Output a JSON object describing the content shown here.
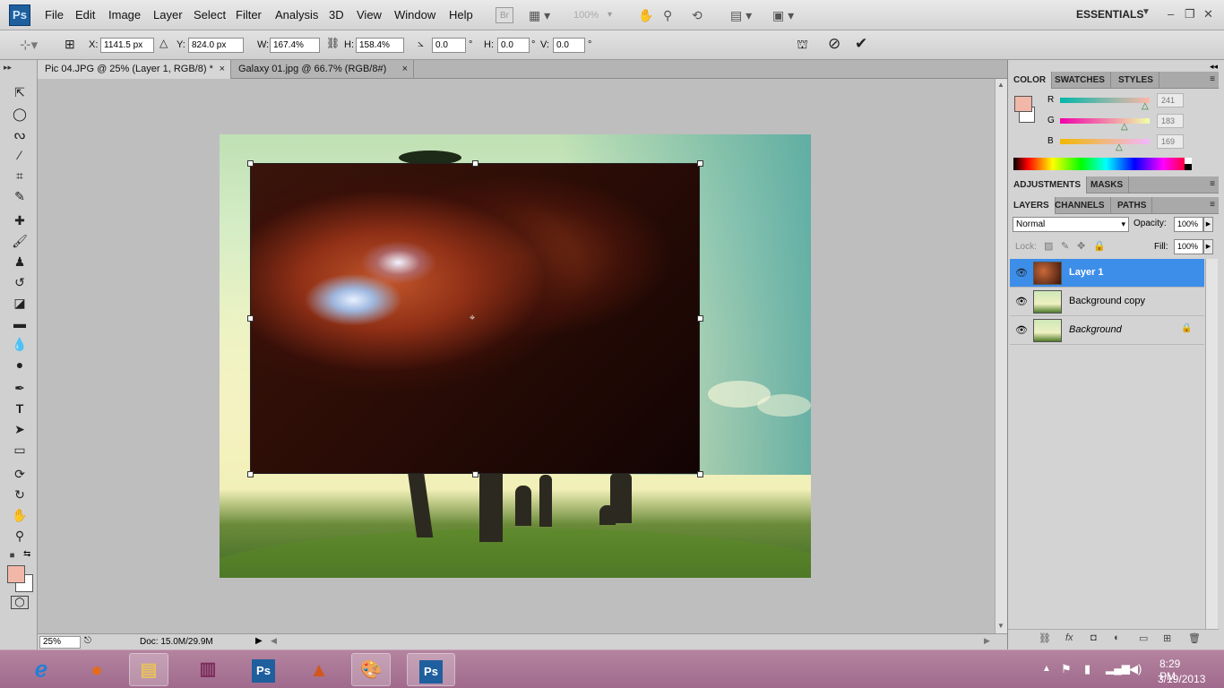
{
  "app": {
    "logo": "Ps"
  },
  "menu": [
    "File",
    "Edit",
    "Image",
    "Layer",
    "Select",
    "Filter",
    "Analysis",
    "3D",
    "View",
    "Window",
    "Help"
  ],
  "toolbar": {
    "br_label": "Br",
    "zoom": "100%",
    "workspace": "ESSENTIALS"
  },
  "options": {
    "x_label": "X:",
    "x_value": "1141.5 px",
    "y_label": "Y:",
    "y_value": "824.0 px",
    "w_label": "W:",
    "w_value": "167.4%",
    "h_label": "H:",
    "h_value": "158.4%",
    "angle_value": "0.0",
    "angle_unit": "°",
    "hskew_label": "H:",
    "hskew_value": "0.0",
    "hskew_unit": "°",
    "vskew_label": "V:",
    "vskew_value": "0.0",
    "vskew_unit": "°"
  },
  "tabs": [
    {
      "label": "Pic 04.JPG @ 25% (Layer 1, RGB/8) *",
      "close": "×"
    },
    {
      "label": "Galaxy 01.jpg @ 66.7% (RGB/8#)",
      "close": "×"
    }
  ],
  "status": {
    "zoom": "25%",
    "doc": "Doc: 15.0M/29.9M"
  },
  "color_panel": {
    "tabs": [
      "COLOR",
      "SWATCHES",
      "STYLES"
    ],
    "channels": [
      {
        "label": "R",
        "value": "241"
      },
      {
        "label": "G",
        "value": "183"
      },
      {
        "label": "B",
        "value": "169"
      }
    ],
    "foreground": "#f1b7a9"
  },
  "adjust_panel": {
    "tabs": [
      "ADJUSTMENTS",
      "MASKS"
    ]
  },
  "layers_panel": {
    "tabs": [
      "LAYERS",
      "CHANNELS",
      "PATHS"
    ],
    "blend_mode": "Normal",
    "opacity_label": "Opacity:",
    "opacity_value": "100%",
    "lock_label": "Lock:",
    "fill_label": "Fill:",
    "fill_value": "100%",
    "layers": [
      {
        "name": "Layer 1",
        "selected": true
      },
      {
        "name": "Background copy",
        "selected": false
      },
      {
        "name": "Background",
        "selected": false,
        "locked": true
      }
    ]
  },
  "taskbar": {
    "time": "8:29 PM",
    "date": "3/19/2013",
    "ps_label": "Ps"
  }
}
